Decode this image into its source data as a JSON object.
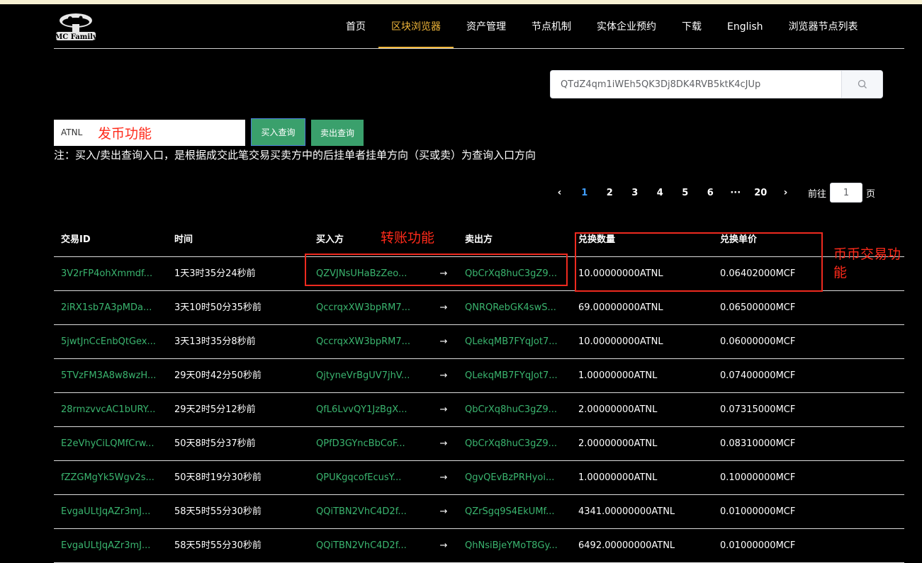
{
  "header": {
    "logo_text": "MC Family",
    "nav": [
      {
        "label": "首页"
      },
      {
        "label": "区块浏览器",
        "active": true
      },
      {
        "label": "资产管理"
      },
      {
        "label": "节点机制"
      },
      {
        "label": "实体企业预约"
      },
      {
        "label": "下载"
      },
      {
        "label": "English"
      },
      {
        "label": "浏览器节点列表"
      }
    ]
  },
  "search": {
    "value": "QTdZ4qm1iWEh5QK3Dj8DK4RVB5ktK4cJUp",
    "icon": "search-icon"
  },
  "token_query": {
    "value": "ATNL",
    "buy_label": "买入查询",
    "sell_label": "卖出查询",
    "note": "注：买入/卖出查询入口，是根据成交此笔交易买卖方中的后挂单者挂单方向（买或卖）为查询入口方向"
  },
  "annotations": {
    "issue": "发币功能",
    "transfer": "转账功能",
    "trade": "币币交易功能",
    "color": "#ff2a1a"
  },
  "pagination": {
    "prev": "‹",
    "pages": [
      "1",
      "2",
      "3",
      "4",
      "5",
      "6",
      "···",
      "20"
    ],
    "active": "1",
    "next": "›",
    "goto_label": "前往",
    "goto_value": "1",
    "goto_suffix": "页"
  },
  "table": {
    "headers": {
      "id": "交易ID",
      "time": "时间",
      "buyer": "买入方",
      "seller": "卖出方",
      "amount": "兑换数量",
      "price": "兑换单价"
    },
    "arrow": "→",
    "rows": [
      {
        "id": "3V2rFP4ohXmmdf...",
        "time": "1天3时35分24秒前",
        "buyer": "QZVJNsUHaBzZeo...",
        "seller": "QbCrXq8huC3gZ9...",
        "amount": "10.00000000ATNL",
        "price": "0.06402000MCF"
      },
      {
        "id": "2iRX1sb7A3pMDa...",
        "time": "3天10时50分35秒前",
        "buyer": "QccrqxXW3bpRM7...",
        "seller": "QNRQRebGK4swS...",
        "amount": "69.00000000ATNL",
        "price": "0.06500000MCF"
      },
      {
        "id": "5jwtJnCcEnbQtGex...",
        "time": "3天13时35分8秒前",
        "buyer": "QccrqxXW3bpRM7...",
        "seller": "QLekqMB7FYqJot7...",
        "amount": "10.00000000ATNL",
        "price": "0.06000000MCF"
      },
      {
        "id": "5TVzFM3A8w8wzH...",
        "time": "29天0时42分50秒前",
        "buyer": "QjtyneVrBgUV7jhV...",
        "seller": "QLekqMB7FYqJot7...",
        "amount": "1.00000000ATNL",
        "price": "0.07400000MCF"
      },
      {
        "id": "28rmzvvcAC1bURY...",
        "time": "29天2时5分12秒前",
        "buyer": "QfL6LvvQY1JzBgX...",
        "seller": "QbCrXq8huC3gZ9...",
        "amount": "2.00000000ATNL",
        "price": "0.07315000MCF"
      },
      {
        "id": "E2eVhyCiLQMfCrw...",
        "time": "50天8时5分37秒前",
        "buyer": "QPfD3GYncBbCoF...",
        "seller": "QbCrXq8huC3gZ9...",
        "amount": "2.00000000ATNL",
        "price": "0.08310000MCF"
      },
      {
        "id": "fZZGMgYk5Wgv2s...",
        "time": "50天8时19分30秒前",
        "buyer": "QPUKgqcofEcusY...",
        "seller": "QgvQEvBzPRHyoi...",
        "amount": "1.00000000ATNL",
        "price": "0.10000000MCF"
      },
      {
        "id": "EvgaULtJqAZr3mJ...",
        "time": "58天5时55分30秒前",
        "buyer": "QQiTBN2VhC4D2f...",
        "seller": "QZrSgq9S4EkUMf...",
        "amount": "4341.00000000ATNL",
        "price": "0.01000000MCF"
      },
      {
        "id": "EvgaULtJqAZr3mJ...",
        "time": "58天5时55分30秒前",
        "buyer": "QQiTBN2VhC4D2f...",
        "seller": "QhNsiBjeYMoT8Gy...",
        "amount": "6492.00000000ATNL",
        "price": "0.01000000MCF"
      }
    ]
  }
}
